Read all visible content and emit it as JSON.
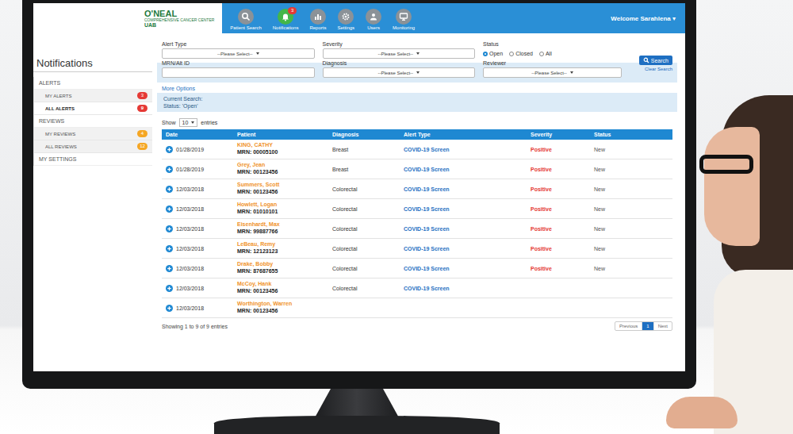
{
  "header": {
    "logo": {
      "title": "O'NEAL",
      "subtitle": "COMPREHENSIVE CANCER CENTER",
      "org": "UAB"
    },
    "nav": [
      {
        "label": "Patient Search",
        "badge": "",
        "selected": false
      },
      {
        "label": "Notifications",
        "badge": "3",
        "selected": true
      },
      {
        "label": "Reports",
        "badge": "",
        "selected": false
      },
      {
        "label": "Settings",
        "badge": "",
        "selected": false
      },
      {
        "label": "Users",
        "badge": "",
        "selected": false
      },
      {
        "label": "Monitoring",
        "badge": "",
        "selected": false
      }
    ],
    "welcome": "Welcome Sarahlena ▾"
  },
  "page_title": "Notifications",
  "sidebar": {
    "sections": [
      {
        "label": "ALERTS",
        "color": "#e53935",
        "items": [
          {
            "label": "MY ALERTS",
            "badge": "3",
            "selected": false
          },
          {
            "label": "ALL ALERTS",
            "badge": "9",
            "selected": true
          }
        ]
      },
      {
        "label": "REVIEWS",
        "color": "#f5a623",
        "items": [
          {
            "label": "MY REVIEWS",
            "badge": "4",
            "selected": false
          },
          {
            "label": "ALL REVIEWS",
            "badge": "12",
            "selected": false
          }
        ]
      },
      {
        "label": "MY SETTINGS",
        "color": "#888888",
        "items": []
      }
    ]
  },
  "filters": {
    "alert_type": {
      "label": "Alert Type",
      "value": "--Please Select--"
    },
    "severity": {
      "label": "Severity",
      "value": "--Please Select--"
    },
    "status": {
      "label": "Status",
      "options": [
        {
          "label": "Open",
          "selected": true
        },
        {
          "label": "Closed",
          "selected": false
        },
        {
          "label": "All",
          "selected": false
        }
      ]
    },
    "mrn": {
      "label": "MRN/Alt ID",
      "value": ""
    },
    "diagnosis": {
      "label": "Diagnosis",
      "value": "--Please Select--"
    },
    "reviewer": {
      "label": "Reviewer",
      "value": "--Please Select--"
    },
    "search_button": "Search",
    "clear": "Clear Search"
  },
  "more_options": "More Options",
  "current_search": {
    "title": "Current Search:",
    "value": "Status: 'Open'"
  },
  "show": {
    "prefix": "Show",
    "value": "10",
    "suffix": "entries"
  },
  "table": {
    "columns": [
      "Date",
      "Patient",
      "Diagnosis",
      "Alert Type",
      "Severity",
      "Status"
    ],
    "rows": [
      {
        "date": "01/28/2019",
        "name": "KING, CATHY",
        "mrn": "MRN: 00005100",
        "diagnosis": "Breast",
        "alert_type": "COVID-19 Screen",
        "severity": "Positive",
        "status": "New"
      },
      {
        "date": "01/28/2019",
        "name": "Grey, Jean",
        "mrn": "MRN: 00123456",
        "diagnosis": "Breast",
        "alert_type": "COVID-19 Screen",
        "severity": "Positive",
        "status": "New"
      },
      {
        "date": "12/03/2018",
        "name": "Summers, Scott",
        "mrn": "MRN: 00123456",
        "diagnosis": "Colorectal",
        "alert_type": "COVID-19 Screen",
        "severity": "Positive",
        "status": "New"
      },
      {
        "date": "12/03/2018",
        "name": "Howlett, Logan",
        "mrn": "MRN: 01010101",
        "diagnosis": "Colorectal",
        "alert_type": "COVID-19 Screen",
        "severity": "Positive",
        "status": "New"
      },
      {
        "date": "12/03/2018",
        "name": "Eisenhardt, Max",
        "mrn": "MRN: 99887766",
        "diagnosis": "Colorectal",
        "alert_type": "COVID-19 Screen",
        "severity": "Positive",
        "status": "New"
      },
      {
        "date": "12/03/2018",
        "name": "LeBeau, Remy",
        "mrn": "MRN: 12123123",
        "diagnosis": "Colorectal",
        "alert_type": "COVID-19 Screen",
        "severity": "Positive",
        "status": "New"
      },
      {
        "date": "12/03/2018",
        "name": "Drake, Bobby",
        "mrn": "MRN: 87687655",
        "diagnosis": "Colorectal",
        "alert_type": "COVID-19 Screen",
        "severity": "Positive",
        "status": "New"
      },
      {
        "date": "12/03/2018",
        "name": "McCoy, Hank",
        "mrn": "MRN: 00123456",
        "diagnosis": "Colorectal",
        "alert_type": "COVID-19 Screen",
        "severity": "",
        "status": ""
      },
      {
        "date": "12/03/2018",
        "name": "Worthington, Warren",
        "mrn": "MRN: 00123456",
        "diagnosis": "",
        "alert_type": "",
        "severity": "",
        "status": ""
      }
    ]
  },
  "footer": {
    "summary": "Showing 1 to 9 of 9 entries",
    "pagination": [
      {
        "label": "Previous",
        "selected": false
      },
      {
        "label": "1",
        "selected": true
      },
      {
        "label": "Next",
        "selected": false
      }
    ]
  }
}
